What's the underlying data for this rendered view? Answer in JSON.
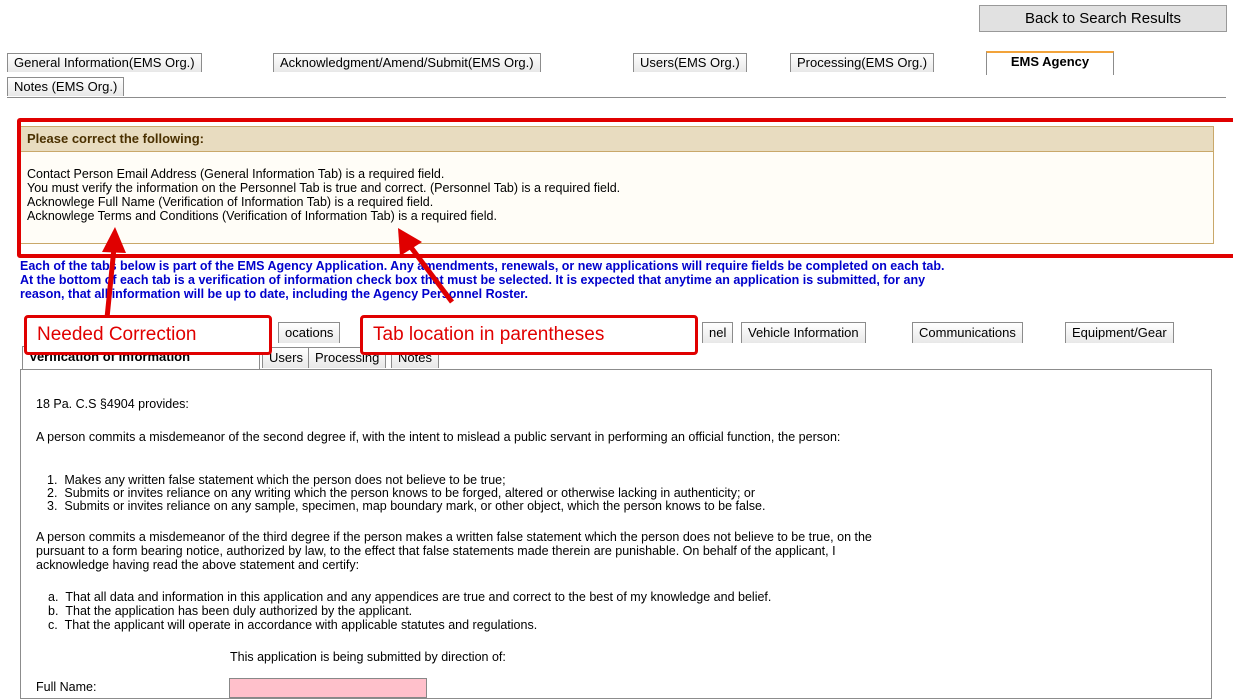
{
  "header": {
    "back_button": "Back to Search Results"
  },
  "top_tabs": [
    "General Information(EMS Org.)",
    "Acknowledgment/Amend/Submit(EMS Org.)",
    "Users(EMS Org.)",
    "Processing(EMS Org.)",
    "EMS Agency",
    "Notes (EMS Org.)"
  ],
  "errors": {
    "heading": "Please correct the following:",
    "lines": [
      "Contact Person Email Address (General Information Tab) is a required field.",
      "You must verify the information on the Personnel Tab is true and correct. (Personnel Tab) is a required field.",
      "Acknowlege Full Name (Verification of Information Tab) is a required field.",
      "Acknowlege Terms and Conditions (Verification of Information Tab) is a required field."
    ]
  },
  "info_text": {
    "line1": "Each of the tabs below is part of the EMS Agency Application. Any amendments, renewals, or new applications will require fields be completed on each tab.",
    "line2": "At the bottom of each tab is a verification of information check box that must be selected. It is expected that anytime an application is submitted, for any",
    "line3": "reason, that all information will be up to date, including the Agency Personnel Roster."
  },
  "inner_tabs": {
    "locations": "ocations",
    "personnel_partial": "nel",
    "vehicle": "Vehicle Information",
    "communications": "Communications",
    "equipment": "Equipment/Gear",
    "verification": "Verification of Information",
    "users": "Users",
    "processing": "Processing",
    "notes": "Notes"
  },
  "callouts": {
    "needed_correction": "Needed Correction",
    "tab_location": "Tab location in parentheses"
  },
  "content": {
    "statute": "18 Pa. C.S §4904 provides:",
    "para1": "A person commits a misdemeanor of the second degree if, with the intent to mislead a public servant in performing an official function, the person:",
    "items1": [
      "Makes any written false statement which the person does not believe to be true;",
      "Submits or invites reliance on any writing which the person knows to be forged, altered or otherwise lacking in authenticity; or",
      "Submits or invites reliance on any sample, specimen, map boundary mark, or other object, which the person knows to be false."
    ],
    "para2_l1": "A person commits a misdemeanor of the third degree if the person makes a written false statement which the person does not believe to be true, on the",
    "para2_l2": "pursuant to a form bearing notice, authorized by law, to the effect that false statements made therein are punishable. On behalf of the applicant, I",
    "para2_l3": "acknowledge having read the above statement and certify:",
    "items2": [
      "That all data and information in this application and any appendices are true and correct to the best of my knowledge and belief.",
      "That the application has been duly authorized by the applicant.",
      "That the applicant will operate in accordance with applicable statutes and regulations."
    ],
    "direction": "This application is being submitted by direction of:",
    "full_name_label": "Full Name:"
  },
  "colors": {
    "error_red": "#e00000",
    "info_blue": "#0000cc",
    "required_pink": "#ffc0cb"
  }
}
